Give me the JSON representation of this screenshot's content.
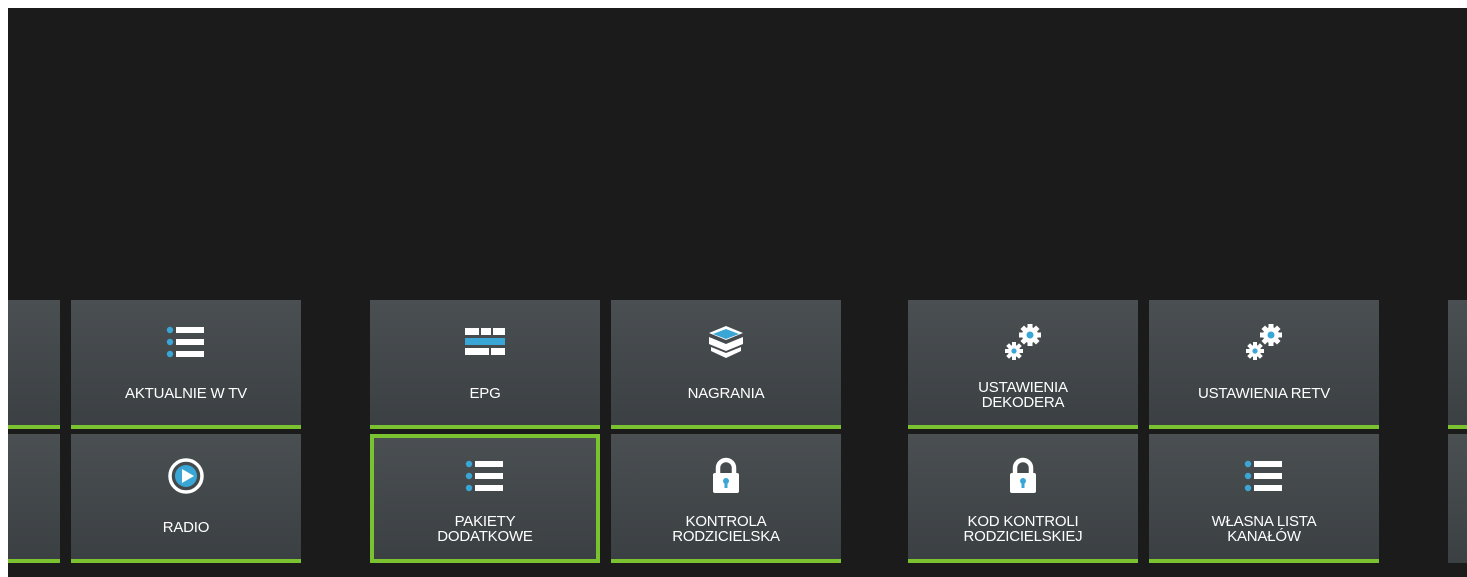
{
  "menu": {
    "tiles": [
      {
        "label": "AKTUALNIE W TV",
        "icon": "list-icon"
      },
      {
        "label": "EPG",
        "icon": "epg-grid-icon"
      },
      {
        "label": "NAGRANIA",
        "icon": "open-box-icon"
      },
      {
        "label": "USTAWIENIA\nDEKODERA",
        "icon": "gears-icon"
      },
      {
        "label": "USTAWIENIA RETV",
        "icon": "gears-icon"
      },
      {
        "label": "RADIO",
        "icon": "play-circle-icon"
      },
      {
        "label": "PAKIETY\nDODATKOWE",
        "icon": "list-icon"
      },
      {
        "label": "KONTROLA\nRODZICIELSKA",
        "icon": "lock-icon"
      },
      {
        "label": "KOD KONTROLI\nRODZICIELSKIEJ",
        "icon": "lock-icon"
      },
      {
        "label": "WŁASNA LISTA\nKANAŁÓW",
        "icon": "list-icon"
      }
    ]
  },
  "colors": {
    "background": "#1b1b1b",
    "tile": "#43484b",
    "accent_green": "#7ac230",
    "icon_blue": "#3aa6d6",
    "icon_white": "#ffffff"
  }
}
